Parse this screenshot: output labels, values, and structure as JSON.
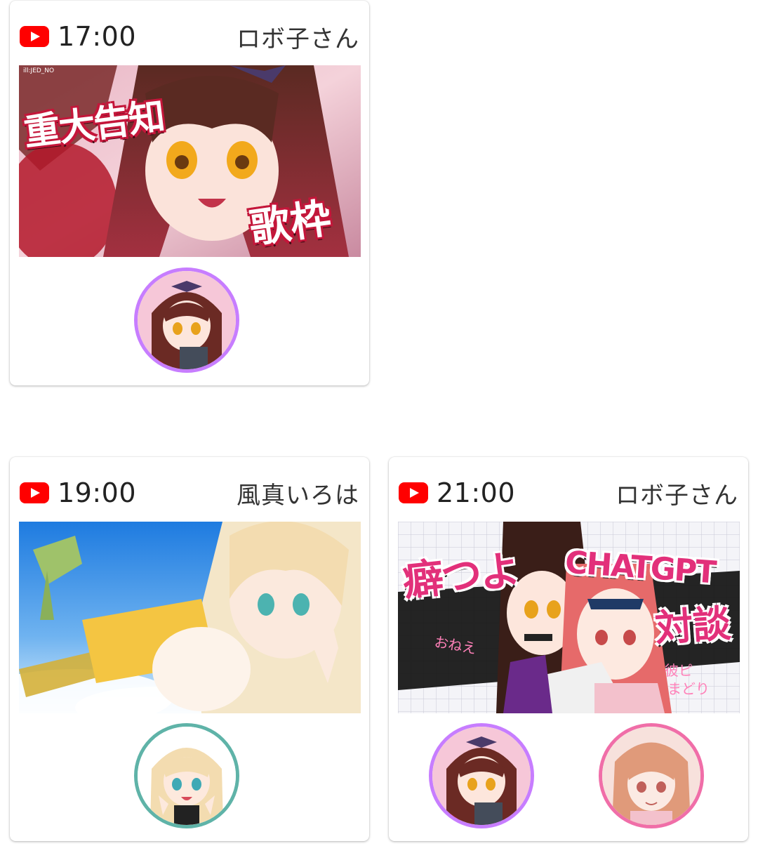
{
  "cards": [
    {
      "time": "17:00",
      "channel": "ロボ子さん",
      "thumbnail": {
        "big_text_1": "重大告知",
        "big_text_2": "歌枠",
        "credit": "ill:JED_NO"
      },
      "avatars": [
        {
          "name": "robo-ko-avatar",
          "ring_color": "#c77dff"
        }
      ]
    },
    {
      "time": "19:00",
      "channel": "風真いろは",
      "thumbnail": {},
      "avatars": [
        {
          "name": "kazama-iroha-avatar",
          "ring_color": "#5fb3a8"
        }
      ]
    },
    {
      "time": "21:00",
      "channel": "ロボ子さん",
      "thumbnail": {
        "big_text_1": "癖つよ",
        "big_text_2": "CHATGPT",
        "big_text_3": "対談",
        "tag_1": "おねえ",
        "tag_2": "彼ピ",
        "tag_3": "まどり"
      },
      "avatars": [
        {
          "name": "robo-ko-avatar",
          "ring_color": "#c77dff"
        },
        {
          "name": "guest-avatar",
          "ring_color": "#f06ea8"
        }
      ]
    }
  ],
  "icons": {
    "youtube": "youtube-icon",
    "youtube_color": "#ff0000"
  }
}
